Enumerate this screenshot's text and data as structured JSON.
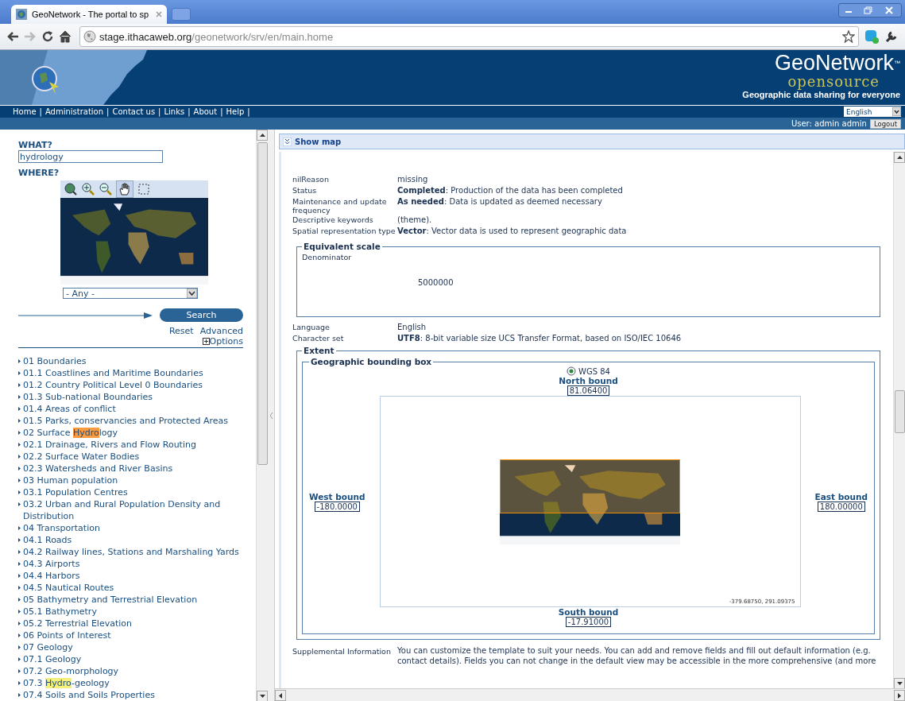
{
  "browser": {
    "tab_title": "GeoNetwork - The portal to sp",
    "url_host": "stage.ithacaweb.org",
    "url_path": "/geonetwork/srv/en/main.home"
  },
  "header": {
    "logo_main": "GeoNetwork",
    "logo_sub": "opensource",
    "trademark": "™",
    "tagline": "Geographic data sharing for everyone"
  },
  "nav": {
    "separator": "|",
    "items": [
      "Home",
      "Administration",
      "Contact us",
      "Links",
      "About",
      "Help"
    ]
  },
  "language": "English",
  "user": {
    "label": "User: admin admin",
    "logout": "Logout"
  },
  "search": {
    "what_label": "WHAT?",
    "what_value": "hydrology",
    "where_label": "WHERE?",
    "region": "- Any -",
    "search_button": "Search",
    "reset": "Reset",
    "advanced": "Advanced",
    "options": "Options"
  },
  "categories": [
    {
      "segments": [
        {
          "text": "01 Boundaries"
        }
      ]
    },
    {
      "segments": [
        {
          "text": "01.1 Coastlines and Maritime Boundaries"
        }
      ]
    },
    {
      "segments": [
        {
          "text": "01.2 Country Political Level 0 Boundaries"
        }
      ]
    },
    {
      "segments": [
        {
          "text": "01.3 Sub-national Boundaries"
        }
      ]
    },
    {
      "segments": [
        {
          "text": "01.4 Areas of conflict"
        }
      ]
    },
    {
      "segments": [
        {
          "text": "01.5 Parks, conservancies and Protected Areas"
        }
      ]
    },
    {
      "segments": [
        {
          "text": "02 Surface "
        },
        {
          "text": "Hydro",
          "color": "#fb9a3e"
        },
        {
          "text": "logy"
        }
      ]
    },
    {
      "segments": [
        {
          "text": "02.1 Drainage, Rivers and Flow Routing"
        }
      ]
    },
    {
      "segments": [
        {
          "text": "02.2 Surface Water Bodies"
        }
      ]
    },
    {
      "segments": [
        {
          "text": "02.3 Watersheds and River Basins"
        }
      ]
    },
    {
      "segments": [
        {
          "text": "03 Human population"
        }
      ]
    },
    {
      "segments": [
        {
          "text": "03.1 Population Centres"
        }
      ]
    },
    {
      "segments": [
        {
          "text": "03.2 Urban and Rural Population Density and Distribution"
        }
      ]
    },
    {
      "segments": [
        {
          "text": "04 Transportation"
        }
      ]
    },
    {
      "segments": [
        {
          "text": "04.1 Roads"
        }
      ]
    },
    {
      "segments": [
        {
          "text": "04.2 Railway lines, Stations and Marshaling Yards"
        }
      ]
    },
    {
      "segments": [
        {
          "text": "04.3 Airports"
        }
      ]
    },
    {
      "segments": [
        {
          "text": "04.4 Harbors"
        }
      ]
    },
    {
      "segments": [
        {
          "text": "04.5 Nautical Routes"
        }
      ]
    },
    {
      "segments": [
        {
          "text": "05 Bathymetry and Terrestrial Elevation"
        }
      ]
    },
    {
      "segments": [
        {
          "text": "05.1 Bathymetry"
        }
      ]
    },
    {
      "segments": [
        {
          "text": "05.2 Terrestrial Elevation"
        }
      ]
    },
    {
      "segments": [
        {
          "text": "06 Points of Interest"
        }
      ]
    },
    {
      "segments": [
        {
          "text": "07 Geology"
        }
      ]
    },
    {
      "segments": [
        {
          "text": "07.1 Geology"
        }
      ]
    },
    {
      "segments": [
        {
          "text": "07.2 Geo-morphology"
        }
      ]
    },
    {
      "segments": [
        {
          "text": "07.3 "
        },
        {
          "text": "Hydro",
          "color": "#f5f07a"
        },
        {
          "text": "-geology"
        }
      ]
    },
    {
      "segments": [
        {
          "text": "07.4 Soils and Soils Properties"
        }
      ]
    }
  ],
  "show_map": "Show map",
  "details": [
    {
      "label": "nilReason",
      "value": "missing"
    },
    {
      "label": "Status",
      "value": "**Completed**: Production of the data has been completed"
    },
    {
      "label": "Maintenance and update frequency",
      "value": "**As needed**: Data is updated as deemed necessary"
    },
    {
      "label": "Descriptive keywords",
      "value": "(theme)."
    },
    {
      "label": "Spatial representation type",
      "value": "**Vector**: Vector data is used to represent geographic data"
    }
  ],
  "equivalent_scale": {
    "legend": "Equivalent scale",
    "label": "Denominator",
    "value": "5000000"
  },
  "details_2": [
    {
      "label": "Language",
      "value": "English"
    },
    {
      "label": "Character set",
      "value": "**UTF8**: 8-bit variable size UCS Transfer Format, based on ISO/IEC 10646"
    }
  ],
  "extent": {
    "legend": "Extent",
    "bbox_legend": "Geographic bounding box",
    "crs": {
      "label": "WGS 84",
      "selected": true
    },
    "north": {
      "label": "North bound",
      "value": "81.06400"
    },
    "west": {
      "label": "West bound",
      "value": "-180.0000"
    },
    "east": {
      "label": "East bound",
      "value": "180.00000"
    },
    "south": {
      "label": "South bound",
      "value": "-17.91000"
    },
    "coordinates": "-379.68750, 291.09375"
  },
  "supplemental": {
    "label": "Supplemental Information",
    "value": "You can customize the template to suit your needs. You can add and remove fields and fill out default information (e.g. contact details). Fields you can not change in the default view may be accessible in the more comprehensive (and more"
  }
}
